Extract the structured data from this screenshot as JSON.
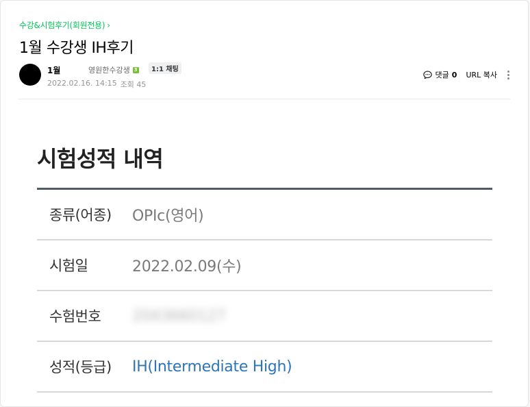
{
  "board": {
    "name": "수강&시험후기(회원전용)",
    "chevron": "›"
  },
  "post": {
    "title": "1월 수강생 IH후기",
    "author": "1월",
    "grade": "영원한수강생",
    "level": "3",
    "chat_label": "1:1 채팅",
    "date": "2022.02.16. 14:15",
    "views_label": "조회 45"
  },
  "tools": {
    "comment_label": "댓글",
    "comment_count": "0",
    "url_copy_label": "URL 복사"
  },
  "result": {
    "heading": "시험성적 내역",
    "rows": [
      {
        "label": "종류(어종)",
        "value": "OPIc(영어)",
        "style": "normal"
      },
      {
        "label": "시험일",
        "value": "2022.02.09(수)",
        "style": "normal"
      },
      {
        "label": "수험번호",
        "value": "2043660127",
        "style": "blurred"
      },
      {
        "label": "성적(등급)",
        "value": "IH(Intermediate High)",
        "style": "highlight"
      }
    ]
  },
  "colors": {
    "accent_green": "#03c75a",
    "grade_blue": "#2d74b8",
    "table_line": "#4f5b66"
  }
}
